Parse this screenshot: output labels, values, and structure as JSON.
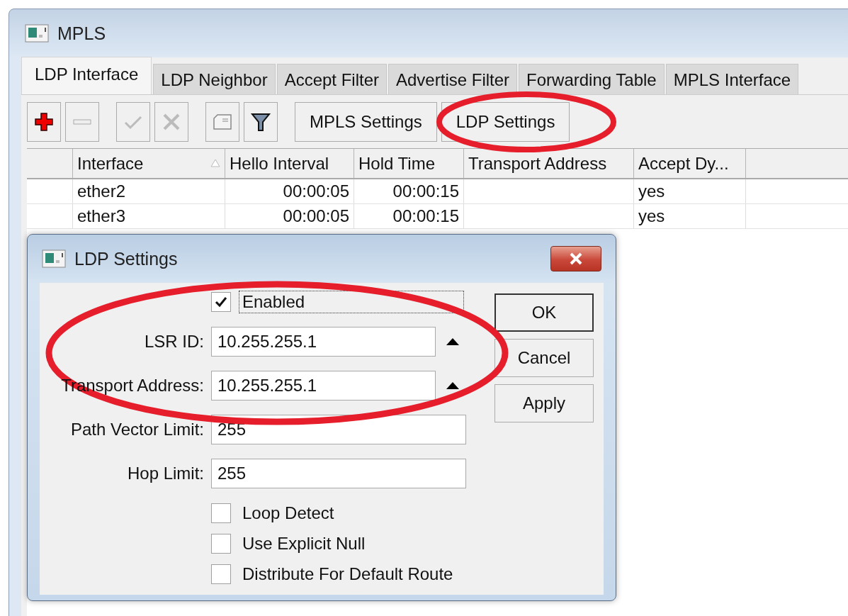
{
  "window": {
    "title": "MPLS"
  },
  "tabs": [
    {
      "label": "LDP Interface",
      "selected": true
    },
    {
      "label": "LDP Neighbor",
      "selected": false
    },
    {
      "label": "Accept Filter",
      "selected": false
    },
    {
      "label": "Advertise Filter",
      "selected": false
    },
    {
      "label": "Forwarding Table",
      "selected": false
    },
    {
      "label": "MPLS Interface",
      "selected": false
    }
  ],
  "toolbar": {
    "icon_buttons": [
      {
        "kind": "add"
      },
      {
        "kind": "remove"
      },
      {
        "kind": "enable"
      },
      {
        "kind": "disable"
      },
      {
        "kind": "comment"
      },
      {
        "kind": "filter"
      }
    ],
    "buttons": [
      {
        "label": "MPLS Settings",
        "circled": false
      },
      {
        "label": "LDP Settings",
        "circled": true
      }
    ]
  },
  "table": {
    "columns": [
      {
        "label": "Interface",
        "sorted": true
      },
      {
        "label": "Hello Interval",
        "sorted": false
      },
      {
        "label": "Hold Time",
        "sorted": false
      },
      {
        "label": "Transport Address",
        "sorted": false
      },
      {
        "label": "Accept Dy...",
        "sorted": false
      }
    ],
    "rows": [
      {
        "cells": [
          "ether2",
          "00:00:05",
          "00:00:15",
          "",
          "yes"
        ]
      },
      {
        "cells": [
          "ether3",
          "00:00:05",
          "00:00:15",
          "",
          "yes"
        ]
      }
    ]
  },
  "dialog": {
    "title": "LDP Settings",
    "enabled": {
      "label": "Enabled",
      "checked": true
    },
    "fields": [
      {
        "label": "LSR ID:",
        "value": "10.255.255.1",
        "kind": "address"
      },
      {
        "label": "Transport Address:",
        "value": "10.255.255.1",
        "kind": "address"
      },
      {
        "label": "Path Vector Limit:",
        "value": "255",
        "kind": "plain"
      },
      {
        "label": "Hop Limit:",
        "value": "255",
        "kind": "plain"
      }
    ],
    "checkboxes": [
      {
        "label": "Loop Detect",
        "checked": false
      },
      {
        "label": "Use Explicit Null",
        "checked": false
      },
      {
        "label": "Distribute For Default Route",
        "checked": false
      }
    ],
    "buttons": [
      {
        "label": "OK",
        "default": true
      },
      {
        "label": "Cancel",
        "default": false
      },
      {
        "label": "Apply",
        "default": false
      }
    ]
  }
}
